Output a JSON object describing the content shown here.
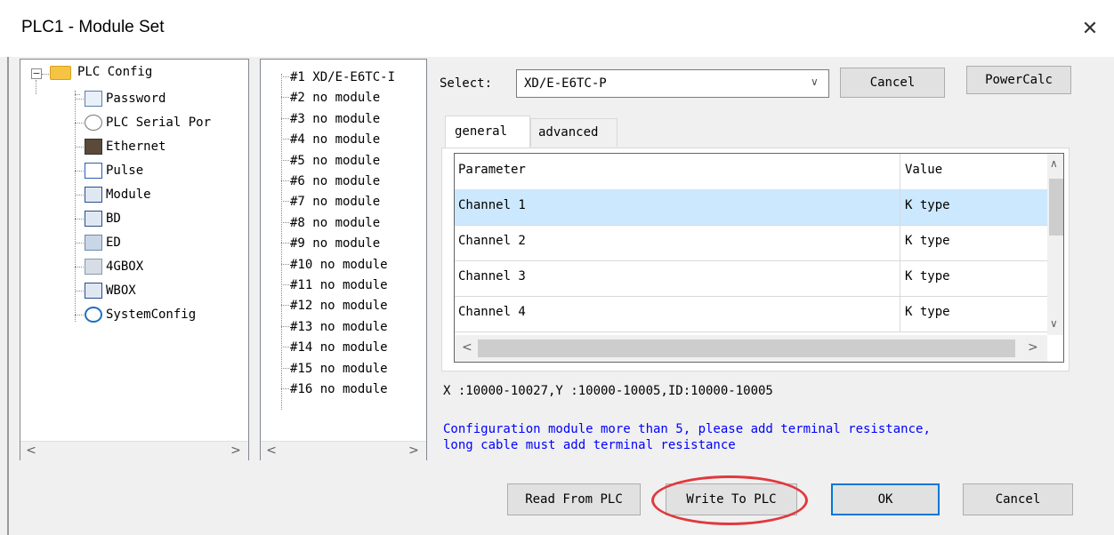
{
  "window": {
    "title": "PLC1 - Module  Set",
    "close_glyph": "✕"
  },
  "tree": {
    "root_label": "PLC Config",
    "items": [
      {
        "label": "Password",
        "icon": "password-icon"
      },
      {
        "label": "PLC Serial Por",
        "icon": "serial-port-icon"
      },
      {
        "label": "Ethernet",
        "icon": "ethernet-icon"
      },
      {
        "label": "Pulse",
        "icon": "pulse-icon"
      },
      {
        "label": "Module",
        "icon": "module-icon"
      },
      {
        "label": "BD",
        "icon": "bd-icon"
      },
      {
        "label": "ED",
        "icon": "ed-icon"
      },
      {
        "label": "4GBOX",
        "icon": "4gbox-icon"
      },
      {
        "label": "WBOX",
        "icon": "wbox-icon"
      },
      {
        "label": "SystemConfig",
        "icon": "system-config-icon"
      }
    ]
  },
  "modules": [
    "#1 XD/E-E6TC-I",
    "#2 no module",
    "#3 no module",
    "#4 no module",
    "#5 no module",
    "#6 no module",
    "#7 no module",
    "#8 no module",
    "#9 no module",
    "#10 no module",
    "#11 no module",
    "#12 no module",
    "#13 no module",
    "#14 no module",
    "#15 no module",
    "#16 no module"
  ],
  "select": {
    "label": "Select:",
    "value": "XD/E-E6TC-P"
  },
  "buttons": {
    "cancel_top": "Cancel",
    "powercalc": "PowerCalc",
    "read": "Read From PLC",
    "write": "Write To PLC",
    "ok": "OK",
    "cancel": "Cancel"
  },
  "tabs": [
    "general",
    "advanced"
  ],
  "grid": {
    "headers": [
      "Parameter",
      "Value"
    ],
    "rows": [
      {
        "param": "Channel 1",
        "value": "K type"
      },
      {
        "param": "Channel 2",
        "value": "K type"
      },
      {
        "param": "Channel 3",
        "value": "K type"
      },
      {
        "param": "Channel 4",
        "value": "K type"
      }
    ]
  },
  "address_info": "X :10000-10027,Y :10000-10005,ID:10000-10005",
  "note": {
    "line1": "Configuration module more than 5, please add terminal resistance,",
    "line2": "long cable must add terminal resistance"
  },
  "colors": {
    "selected_row": "#cce8ff",
    "note_text": "#0000ff",
    "highlight_circle": "#e0393e",
    "ok_border": "#0078d7",
    "folder": "#f6c443"
  }
}
